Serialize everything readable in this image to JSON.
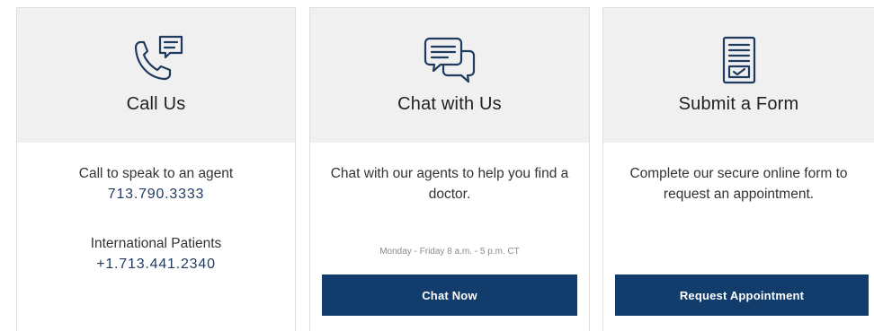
{
  "cards": [
    {
      "icon": "phone-chat-icon",
      "title": "Call Us",
      "line1": "Call to speak to an agent",
      "phone1": "713.790.3333",
      "line2": "International Patients",
      "phone2": "+1.713.441.2340"
    },
    {
      "icon": "chat-bubbles-icon",
      "title": "Chat with Us",
      "text": "Chat with our agents to help you find a doctor.",
      "hours": "Monday - Friday 8 a.m. - 5 p.m. CT",
      "button": "Chat Now"
    },
    {
      "icon": "form-checklist-icon",
      "title": "Submit a Form",
      "text": "Complete our secure online form to request an appointment.",
      "button": "Request Appointment"
    }
  ],
  "colors": {
    "header_bg": "#f0f0f0",
    "icon_color": "#1e3a5f",
    "button_bg": "#123c6b",
    "phone_text": "#1e3a5f"
  }
}
